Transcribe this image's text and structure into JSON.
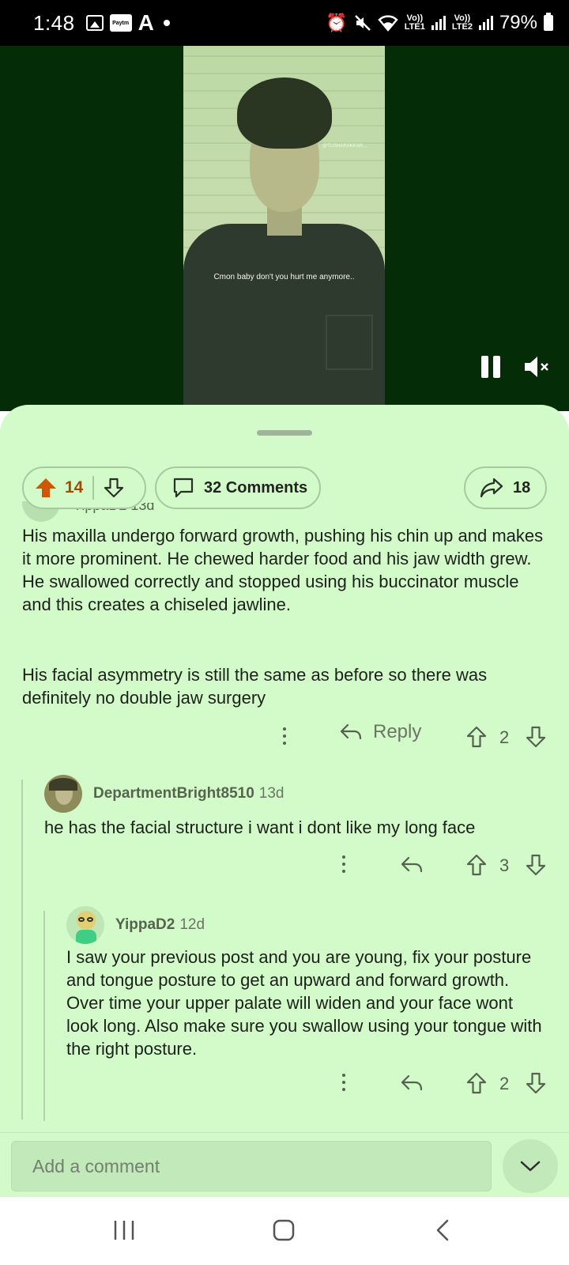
{
  "status_bar": {
    "time": "1:48",
    "left_icons": [
      "gallery-icon",
      "paytm-icon",
      "a-app-icon",
      "dot-icon"
    ],
    "paytm_text": "Paytm",
    "a_text": "A",
    "right_icons": [
      "alarm-icon",
      "mute-icon",
      "wifi-icon",
      "signal-lte1-icon",
      "signal-lte2-icon",
      "battery-icon"
    ],
    "net1_top": "Vo))",
    "net1_bottom": "LTE1",
    "net2_top": "Vo))",
    "net2_bottom": "LTE2",
    "battery": "79%"
  },
  "video": {
    "watermark": "@TUSHARAKKAR...",
    "caption": "Cmon baby don't you hurt me anymore..",
    "controls": [
      "pause-icon",
      "volume-muted-icon"
    ]
  },
  "post_actions": {
    "upvotes": "14",
    "comments_label": "32 Comments",
    "shares": "18",
    "accent": "#d45500"
  },
  "comments": [
    {
      "author_partial": "YippaD2  13d",
      "text_p1": "His maxilla undergo forward growth, pushing his chin up and makes it more prominent. He chewed harder food and his jaw width grew. He swallowed correctly and stopped using his buccinator muscle and this creates a chiseled jawline.",
      "text_p2": "His facial asymmetry is still the same as before so there was definitely no double jaw surgery",
      "reply_label": "Reply",
      "score": "2"
    },
    {
      "author": "DepartmentBright8510",
      "time": "13d",
      "text": "he has the facial structure i want i dont like my long face",
      "score": "3"
    },
    {
      "author": "YippaD2",
      "time": "12d",
      "text": "I saw your previous post and you are young, fix your posture and tongue posture to get an upward and forward growth. Over time your upper palate will widen and your face wont look long. Also make sure you swallow using your tongue with the right posture.",
      "score": "2"
    }
  ],
  "composer": {
    "placeholder": "Add a comment"
  },
  "nav_bar": {
    "buttons": [
      "recents-icon",
      "home-icon",
      "back-icon"
    ]
  }
}
